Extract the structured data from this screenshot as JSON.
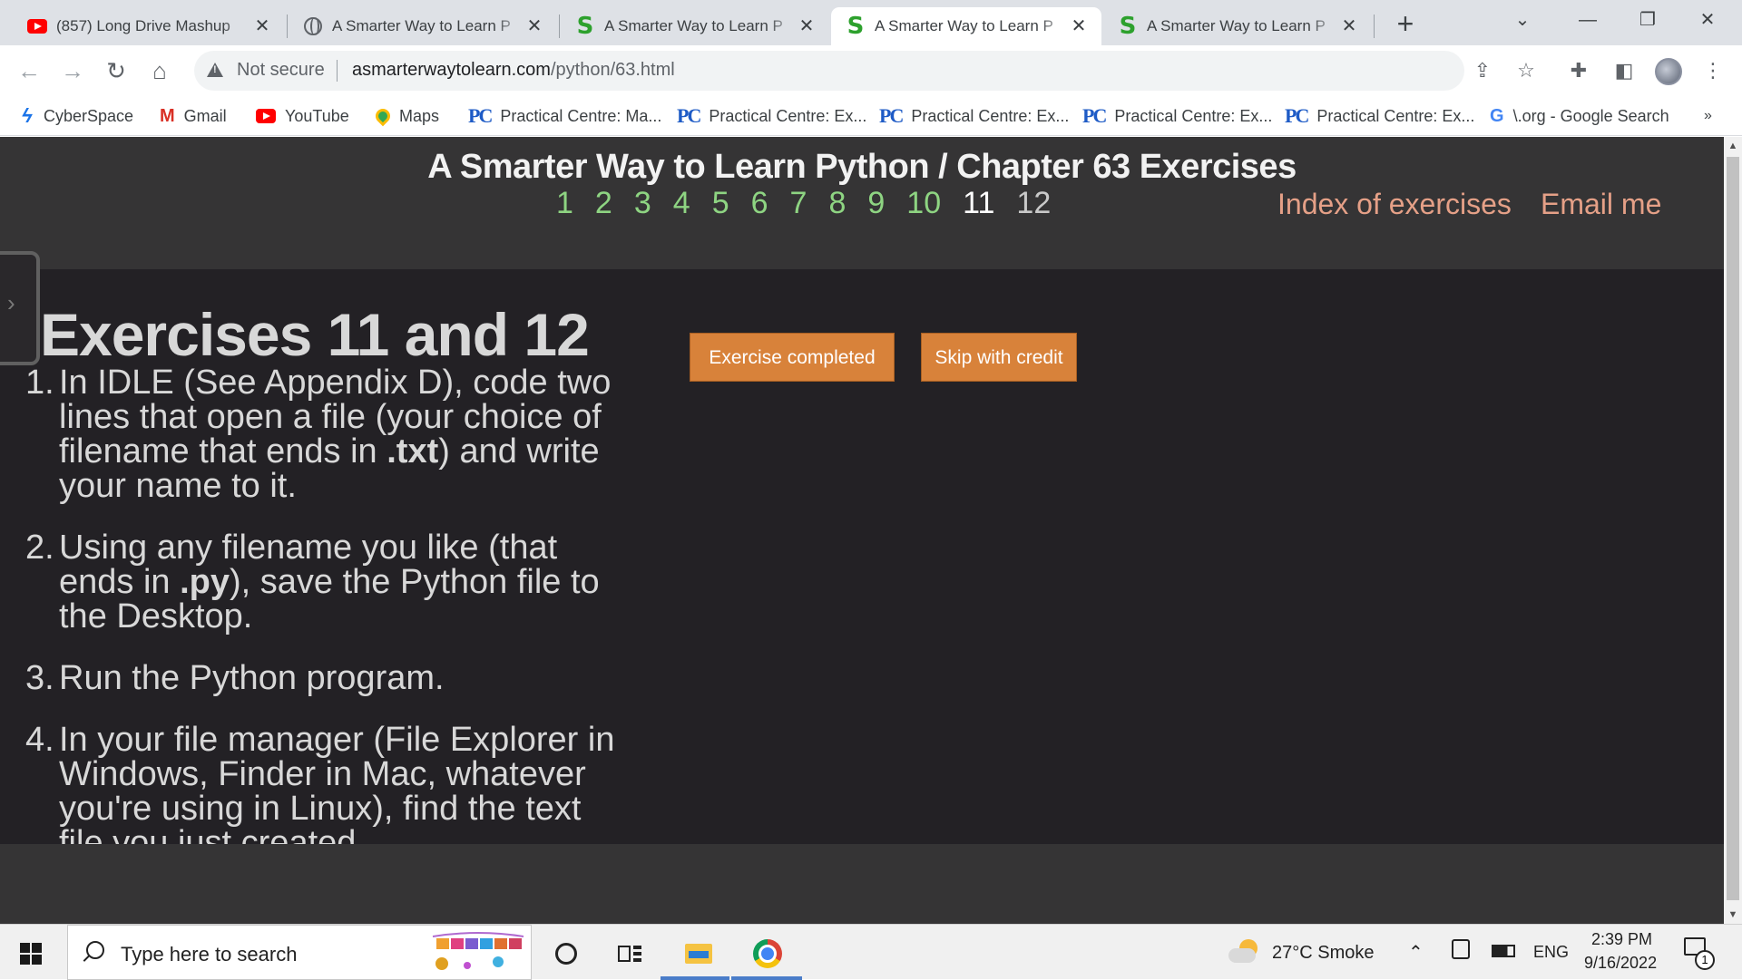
{
  "tabs": [
    {
      "title": "(857) Long Drive Mashup",
      "icon": "youtube-icon",
      "active": false
    },
    {
      "title": "A Smarter Way to Learn P",
      "icon": "globe-icon",
      "active": false
    },
    {
      "title": "A Smarter Way to Learn P",
      "icon": "s-site-icon",
      "active": false
    },
    {
      "title": "A Smarter Way to Learn P",
      "icon": "s-site-icon",
      "active": true
    },
    {
      "title": "A Smarter Way to Learn P",
      "icon": "s-site-icon",
      "active": false
    }
  ],
  "tab_close_glyph": "✕",
  "new_tab_glyph": "+",
  "window_controls": {
    "dropdown": "⌄",
    "minimize": "—",
    "restore": "❐",
    "close": "✕"
  },
  "address_bar": {
    "security_text": "Not secure",
    "url_domain": "asmarterwaytolearn.com",
    "url_path": "/python/63.html"
  },
  "nav_glyphs": {
    "back": "←",
    "forward": "→",
    "reload": "↻",
    "home": "⌂"
  },
  "toolbar_glyphs": {
    "share": "⇪",
    "bookmark": "☆",
    "extensions": "✚",
    "sidepanel": "◧",
    "menu": "⋮"
  },
  "bookmarks": [
    {
      "label": "CyberSpace",
      "icon": "cyberspace-icon"
    },
    {
      "label": "Gmail",
      "icon": "gmail-icon"
    },
    {
      "label": "YouTube",
      "icon": "youtube-icon"
    },
    {
      "label": "Maps",
      "icon": "maps-icon"
    },
    {
      "label": "Practical Centre: Ma...",
      "icon": "pc-icon"
    },
    {
      "label": "Practical Centre: Ex...",
      "icon": "pc-icon"
    },
    {
      "label": "Practical Centre: Ex...",
      "icon": "pc-icon"
    },
    {
      "label": "Practical Centre: Ex...",
      "icon": "pc-icon"
    },
    {
      "label": "Practical Centre: Ex...",
      "icon": "pc-icon"
    },
    {
      "label": "\\.org - Google Search",
      "icon": "google-icon"
    }
  ],
  "bookmarks_overflow": "»",
  "page": {
    "site_title": "A Smarter Way to Learn Python / Chapter 63 Exercises",
    "exercise_numbers": [
      "1",
      "2",
      "3",
      "4",
      "5",
      "6",
      "7",
      "8",
      "9",
      "10",
      "11",
      "12"
    ],
    "current_exercise": "11",
    "index_link": "Index of exercises",
    "email_link": "Email me",
    "heading": "Exercises 11 and 12",
    "exercises": [
      {
        "num": "1.",
        "parts": [
          "In IDLE (See Appendix D), code two lines that open a file (your choice of filename that ends in ",
          ".txt",
          ") and write your name to it."
        ]
      },
      {
        "num": "2.",
        "parts": [
          "Using any filename you like (that ends in ",
          ".py",
          "), save the Python file to the Desktop."
        ]
      },
      {
        "num": "3.",
        "parts": [
          "Run the Python program.",
          "",
          ""
        ]
      },
      {
        "num": "4.",
        "parts": [
          "In your file manager (File Explorer in Windows, Finder in Mac, whatever you're using in Linux), find the text file you just created",
          "",
          ""
        ]
      }
    ],
    "completed_button": "Exercise completed",
    "skip_button": "Skip with credit",
    "side_tab_glyph": "›"
  },
  "scrollbar": {
    "up": "▲",
    "down": "▼"
  },
  "taskbar": {
    "search_placeholder": "Type here to search",
    "weather": "27°C  Smoke",
    "chevron": "⌃",
    "language": "ENG",
    "time": "2:39 PM",
    "date": "9/16/2022",
    "notification_count": "1"
  }
}
